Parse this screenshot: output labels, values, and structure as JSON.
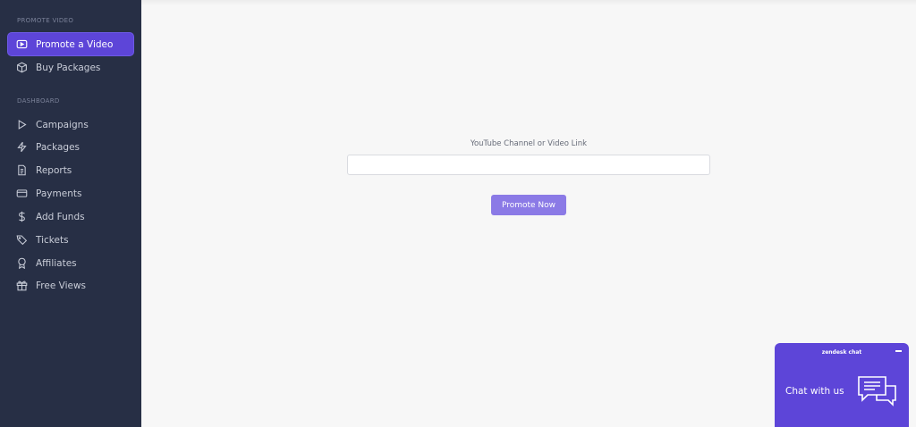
{
  "sidebar": {
    "section_promote": "PROMOTE VIDEO",
    "section_dashboard": "DASHBOARD",
    "promote_items": [
      {
        "label": "Promote a Video",
        "icon": "video-play-icon",
        "active": true
      },
      {
        "label": "Buy Packages",
        "icon": "box-icon",
        "active": false
      }
    ],
    "dashboard_items": [
      {
        "label": "Campaigns",
        "icon": "play-triangle-icon"
      },
      {
        "label": "Packages",
        "icon": "lightning-icon"
      },
      {
        "label": "Reports",
        "icon": "document-icon"
      },
      {
        "label": "Payments",
        "icon": "credit-card-icon"
      },
      {
        "label": "Add Funds",
        "icon": "dollar-icon"
      },
      {
        "label": "Tickets",
        "icon": "tag-icon"
      },
      {
        "label": "Affiliates",
        "icon": "award-icon"
      },
      {
        "label": "Free Views",
        "icon": "gift-icon"
      }
    ]
  },
  "main": {
    "field_label": "YouTube Channel or Video Link",
    "field_value": "",
    "field_placeholder": "",
    "submit_label": "Promote Now"
  },
  "chat": {
    "header": "zendesk chat",
    "cta": "Chat with us"
  },
  "colors": {
    "sidebar_bg": "#272f45",
    "accent": "#5d45d8",
    "button": "#8b7ae6"
  }
}
